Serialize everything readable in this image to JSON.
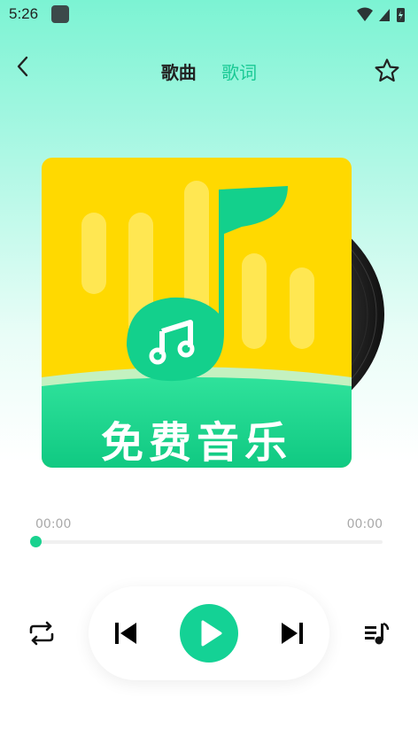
{
  "status_bar": {
    "time": "5:26"
  },
  "header": {
    "tabs": [
      {
        "label": "歌曲"
      },
      {
        "label": "歌词"
      }
    ]
  },
  "cover": {
    "title": "免费音乐"
  },
  "progress": {
    "current": "00:00",
    "total": "00:00",
    "fraction": 0
  },
  "colors": {
    "accent": "#14d295",
    "cover_yellow": "#ffd900",
    "cover_green": "#13d08c"
  },
  "icons": [
    "back-arrow-icon",
    "star-icon",
    "repeat-icon",
    "previous-icon",
    "play-icon",
    "next-icon",
    "playlist-icon"
  ]
}
